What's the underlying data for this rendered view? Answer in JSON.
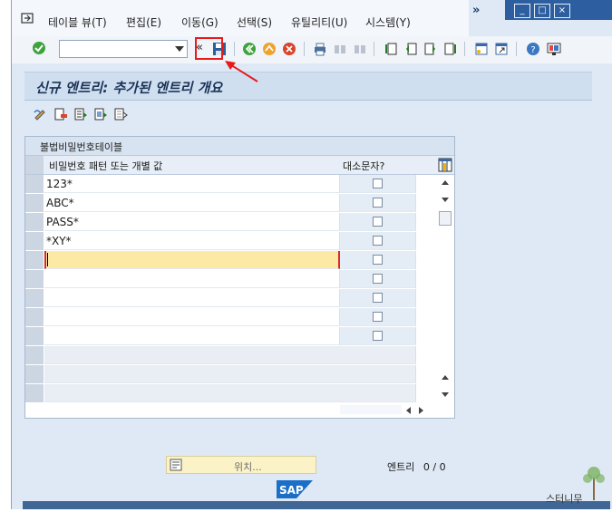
{
  "menu": {
    "items": [
      "테이블 뷰(T)",
      "편집(E)",
      "이동(G)",
      "선택(S)",
      "유틸리티(U)",
      "시스템(Y)"
    ],
    "overflow": "»"
  },
  "window_controls": {
    "minimize": "_",
    "maximize": "□",
    "close": "×"
  },
  "toolbar": {
    "command_value": "",
    "collapse_glyph": "«",
    "icons": [
      "enter-icon",
      "save-icon",
      "back-icon",
      "exit-icon",
      "cancel-icon",
      "print-icon",
      "find-icon",
      "find-next-icon",
      "first-page-icon",
      "prev-page-icon",
      "next-page-icon",
      "last-page-icon",
      "new-session-icon",
      "shortcut-icon",
      "help-icon",
      "layout-icon"
    ]
  },
  "screen": {
    "title": "신규 엔트리: 추가된 엔트리 개요"
  },
  "app_toolbar": {
    "icons": [
      "change-display-icon",
      "delete-icon",
      "select-all-icon",
      "select-block-icon",
      "deselect-all-icon"
    ]
  },
  "table": {
    "title": "불법비밀번호테이블",
    "columns": [
      "비밀번호 패턴 또는 개별 값",
      "대소문자?"
    ],
    "rows": [
      {
        "value": "123*",
        "case": false
      },
      {
        "value": "ABC*",
        "case": false
      },
      {
        "value": "PASS*",
        "case": false
      },
      {
        "value": "*XY*",
        "case": false
      },
      {
        "value": "",
        "case": false,
        "active": true
      },
      {
        "value": "",
        "case": false
      },
      {
        "value": "",
        "case": false
      },
      {
        "value": "",
        "case": false
      },
      {
        "value": "",
        "case": false
      }
    ],
    "empty_rows": 3
  },
  "footer": {
    "position_button": "위치...",
    "entry_label": "엔트리",
    "entry_count": "0 / 0"
  },
  "logo": "SAP",
  "watermark": "스터니무",
  "colors": {
    "highlight": "#e81a1a",
    "active_row": "#fde9a3",
    "title_text": "#1b3356",
    "status_bar": "#3f6695"
  }
}
